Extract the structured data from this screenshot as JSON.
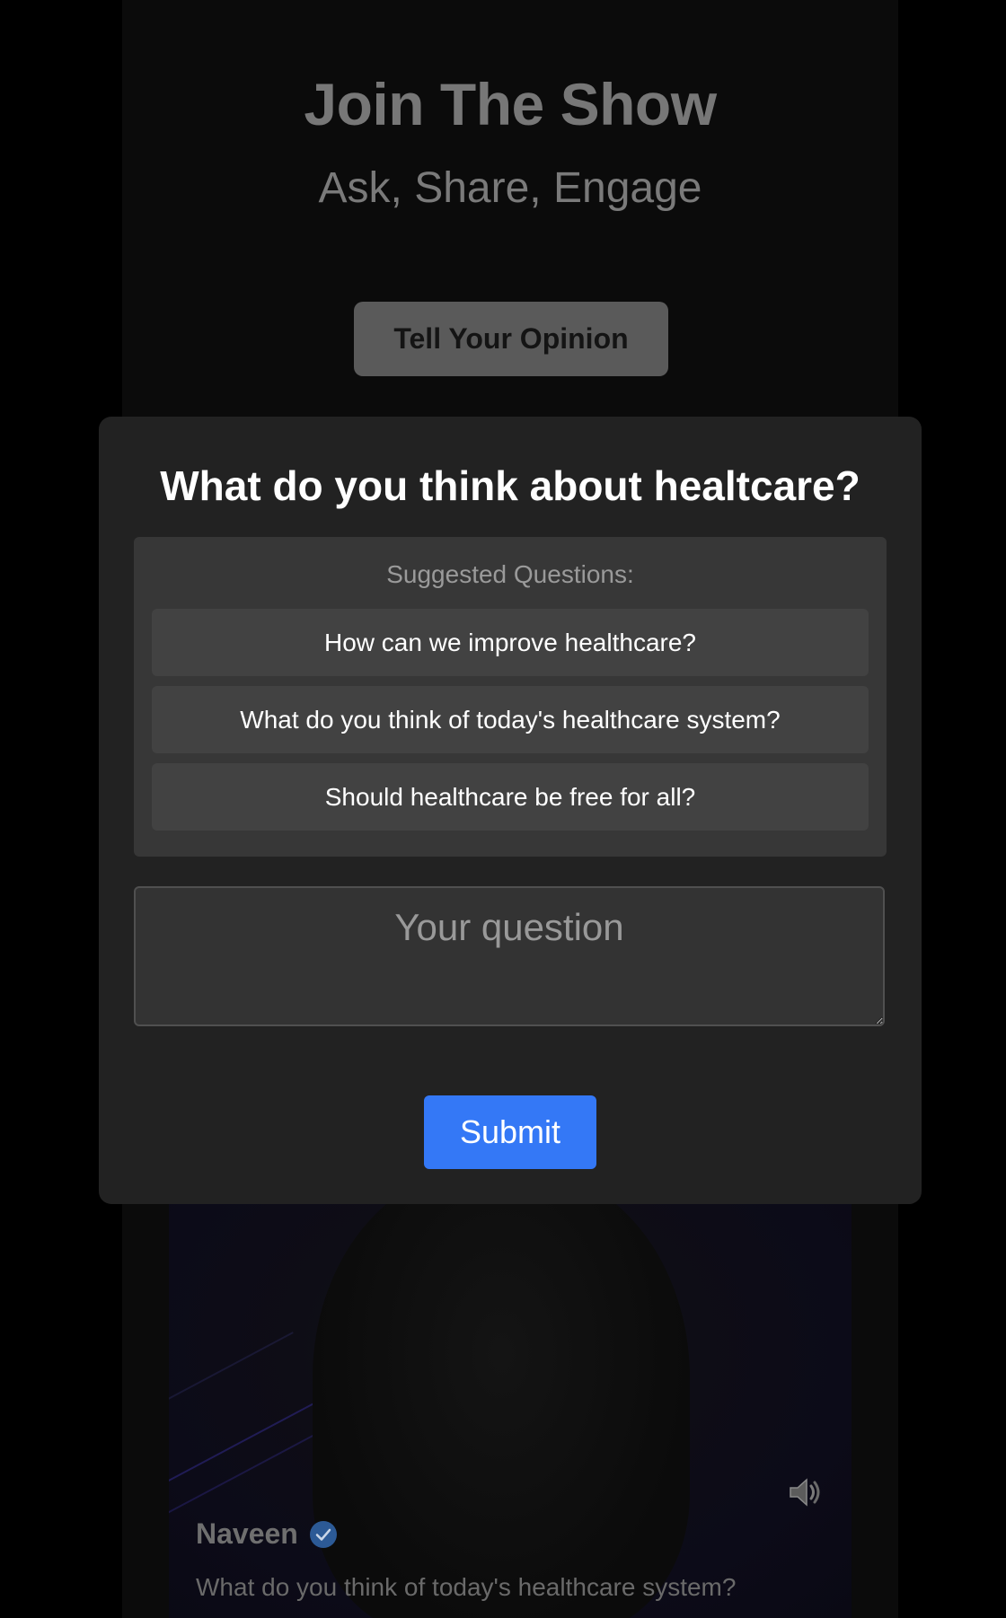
{
  "hero": {
    "title": "Join The Show",
    "subtitle": "Ask, Share, Engage",
    "opinion_button_label": "Tell Your Opinion"
  },
  "modal": {
    "title": "What do you think about healtcare?",
    "suggestions_label": "Suggested Questions:",
    "suggestions": [
      {
        "label": "How can we improve healthcare?"
      },
      {
        "label": "What do you think of today's healthcare system?"
      },
      {
        "label": "Should healthcare be free for all?"
      }
    ],
    "question_placeholder": "Your question",
    "submit_label": "Submit"
  },
  "video": {
    "caller_name": "Naveen",
    "caller_question": "What do you think of today's healthcare system?",
    "verified_icon": "verified-check-icon",
    "speaker_icon": "speaker-icon"
  },
  "colors": {
    "accent": "#3478f6",
    "modal_bg": "#222222",
    "page_bg": "#000000"
  }
}
